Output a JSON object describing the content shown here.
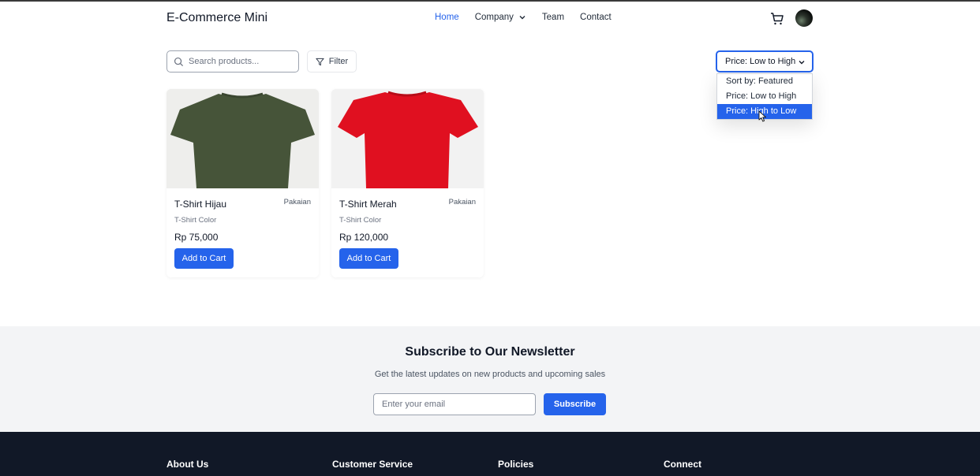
{
  "header": {
    "logo": "E-Commerce Mini",
    "nav": [
      {
        "label": "Home",
        "active": true
      },
      {
        "label": "Company",
        "dropdown": true
      },
      {
        "label": "Team"
      },
      {
        "label": "Contact"
      }
    ],
    "cart_icon": "cart-icon",
    "accent_color": "#2563eb"
  },
  "toolbar": {
    "search_placeholder": "Search products...",
    "filter_label": "Filter",
    "sort": {
      "selected": "Price: Low to High",
      "options": [
        "Sort by: Featured",
        "Price: Low to High",
        "Price: High to Low"
      ],
      "highlighted": "Price: High to Low"
    }
  },
  "products": [
    {
      "name": "T-Shirt Hijau",
      "category": "Pakaian",
      "description": "T-Shirt Color",
      "price": "Rp 75,000",
      "button": "Add to Cart",
      "color": "#465439"
    },
    {
      "name": "T-Shirt Merah",
      "category": "Pakaian",
      "description": "T-Shirt Color",
      "price": "Rp 120,000",
      "button": "Add to Cart",
      "color": "#e01020"
    }
  ],
  "newsletter": {
    "title": "Subscribe to Our Newsletter",
    "subtitle": "Get the latest updates on new products and upcoming sales",
    "email_placeholder": "Enter your email",
    "button": "Subscribe"
  },
  "footer": {
    "columns": [
      "About Us",
      "Customer Service",
      "Policies",
      "Connect"
    ]
  }
}
